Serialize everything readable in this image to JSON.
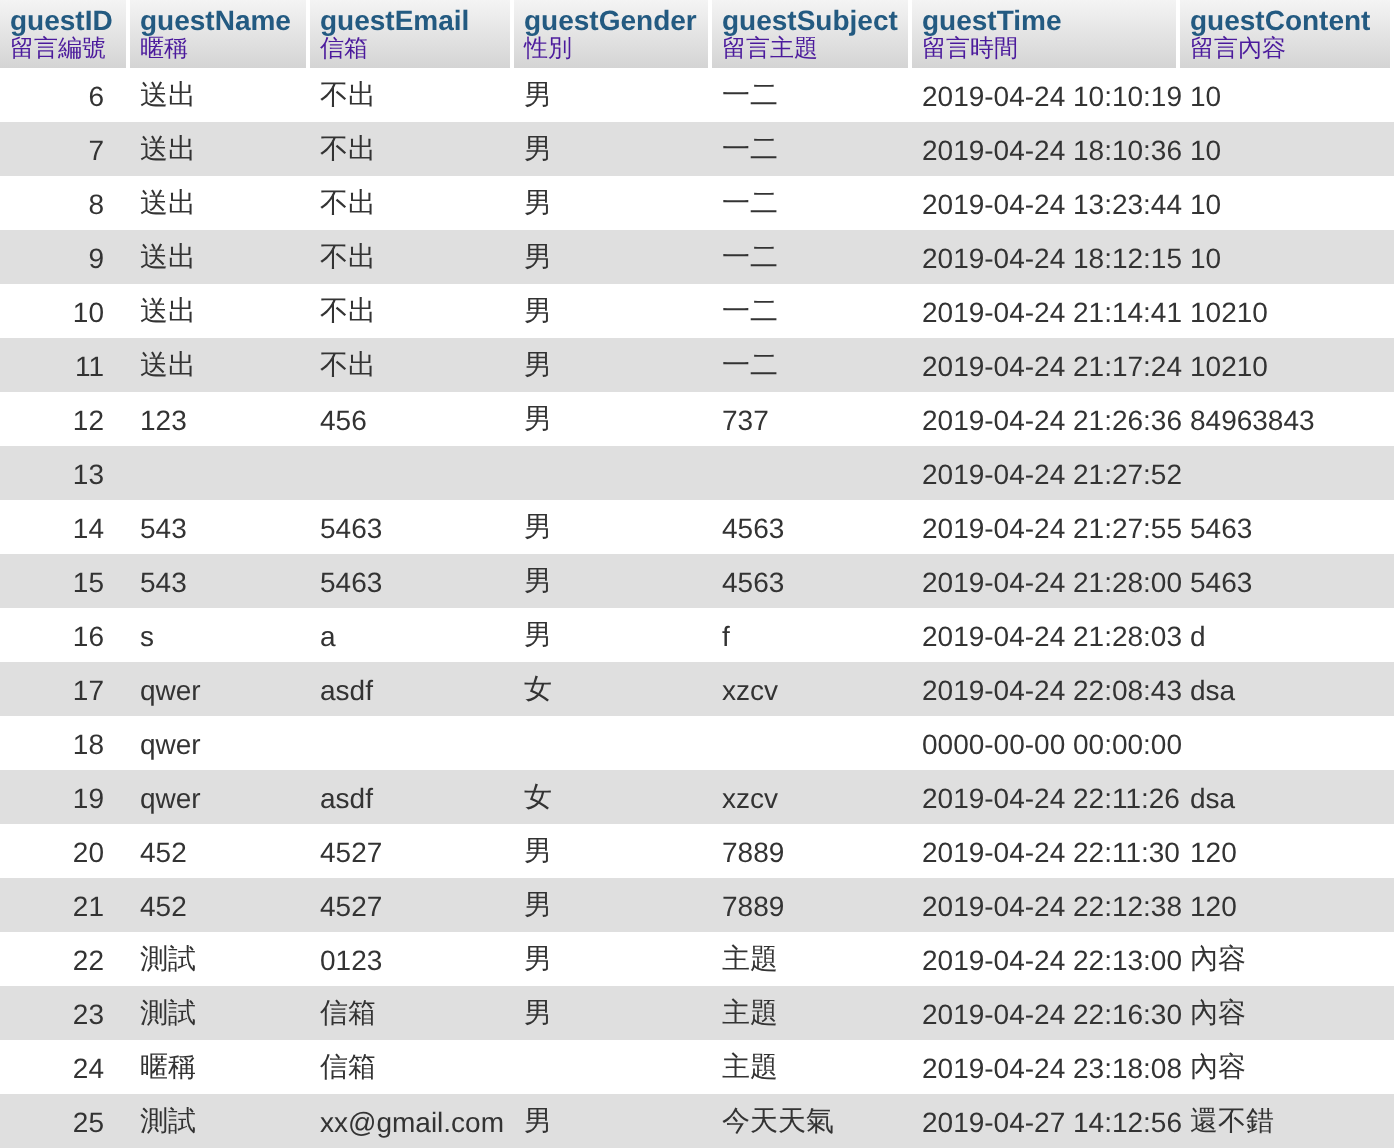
{
  "columns": [
    {
      "field": "guestID",
      "note": "留言編號"
    },
    {
      "field": "guestName",
      "note": "暱稱"
    },
    {
      "field": "guestEmail",
      "note": "信箱"
    },
    {
      "field": "guestGender",
      "note": "性別"
    },
    {
      "field": "guestSubject",
      "note": "留言主題"
    },
    {
      "field": "guestTime",
      "note": "留言時間"
    },
    {
      "field": "guestContent",
      "note": "留言內容"
    }
  ],
  "rows": [
    [
      "6",
      "送出",
      "不出",
      "男",
      "一二",
      "2019-04-24 10:10:19",
      "10"
    ],
    [
      "7",
      "送出",
      "不出",
      "男",
      "一二",
      "2019-04-24 18:10:36",
      "10"
    ],
    [
      "8",
      "送出",
      "不出",
      "男",
      "一二",
      "2019-04-24 13:23:44",
      "10"
    ],
    [
      "9",
      "送出",
      "不出",
      "男",
      "一二",
      "2019-04-24 18:12:15",
      "10"
    ],
    [
      "10",
      "送出",
      "不出",
      "男",
      "一二",
      "2019-04-24 21:14:41",
      "10210"
    ],
    [
      "11",
      "送出",
      "不出",
      "男",
      "一二",
      "2019-04-24 21:17:24",
      "10210"
    ],
    [
      "12",
      "123",
      "456",
      "男",
      "737",
      "2019-04-24 21:26:36",
      "84963843"
    ],
    [
      "13",
      null,
      null,
      null,
      null,
      "2019-04-24 21:27:52",
      null
    ],
    [
      "14",
      "543",
      "5463",
      "男",
      "4563",
      "2019-04-24 21:27:55",
      "5463"
    ],
    [
      "15",
      "543",
      "5463",
      "男",
      "4563",
      "2019-04-24 21:28:00",
      "5463"
    ],
    [
      "16",
      "s",
      "a",
      "男",
      "f",
      "2019-04-24 21:28:03",
      "d"
    ],
    [
      "17",
      "qwer",
      "asdf",
      "女",
      "xzcv",
      "2019-04-24 22:08:43",
      "dsa"
    ],
    [
      "18",
      "qwer",
      null,
      null,
      null,
      "0000-00-00 00:00:00",
      null
    ],
    [
      "19",
      "qwer",
      "asdf",
      "女",
      "xzcv",
      "2019-04-24 22:11:26",
      "dsa"
    ],
    [
      "20",
      "452",
      "4527",
      "男",
      "7889",
      "2019-04-24 22:11:30",
      "120"
    ],
    [
      "21",
      "452",
      "4527",
      "男",
      "7889",
      "2019-04-24 22:12:38",
      "120"
    ],
    [
      "22",
      "測試",
      "0123",
      "男",
      "主題",
      "2019-04-24 22:13:00",
      "內容"
    ],
    [
      "23",
      "測試",
      "信箱",
      "男",
      "主題",
      "2019-04-24 22:16:30",
      "內容"
    ],
    [
      "24",
      "暱稱",
      "信箱",
      null,
      "主題",
      "2019-04-24 23:18:08",
      "內容"
    ],
    [
      "25",
      "測試",
      "xx@gmail.com",
      "男",
      "今天天氣",
      "2019-04-27 14:12:56",
      "還不錯"
    ]
  ]
}
